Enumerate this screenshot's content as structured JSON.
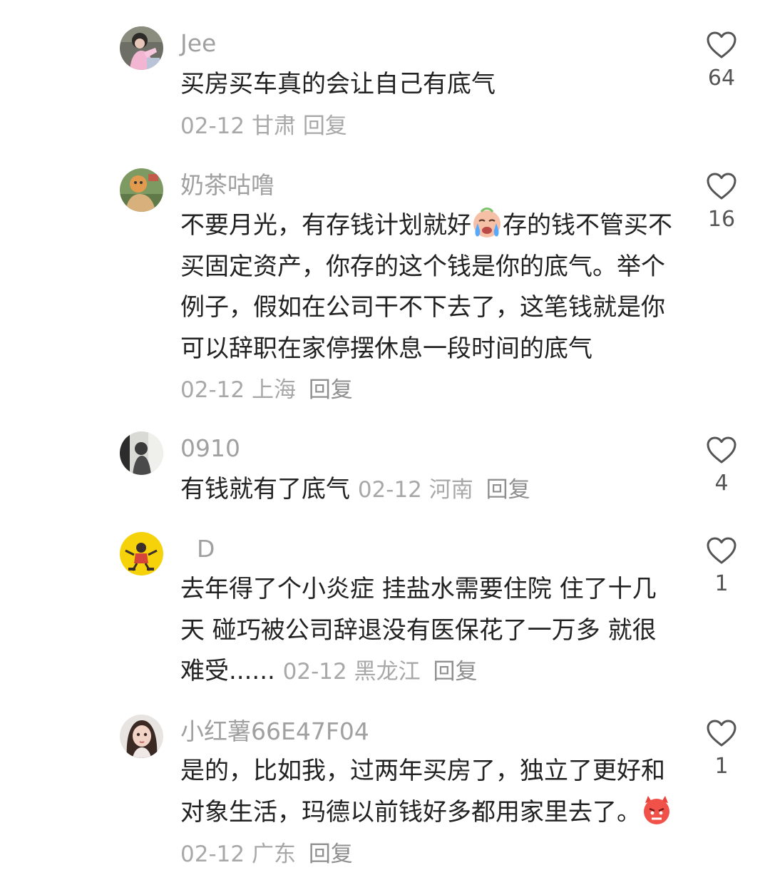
{
  "comments": [
    {
      "username": "Jee",
      "text": "买房买车真的会让自己有底气",
      "date": "02-12",
      "location": "甘肃",
      "reply_label": "回复",
      "likes": "64",
      "avatar_icon": "avatar-girl-pink-icon"
    },
    {
      "username": "奶茶咕噜",
      "text_before_emoji": "不要月光，有存钱计划就好",
      "emoji": "crying-face-emoji",
      "text_after_emoji": "存的钱不管买不买固定资产，你存的这个钱是你的底气。举个例子，假如在公司干不下去了，这笔钱就是你可以辞职在家停摆休息一段时间的底气",
      "date": "02-12",
      "location": "上海",
      "reply_label": "回复",
      "likes": "16",
      "avatar_icon": "avatar-cartoon-icon"
    },
    {
      "username": "0910",
      "text": "有钱就有了底气",
      "date": "02-12",
      "location": "河南",
      "reply_label": "回复",
      "likes": "4",
      "avatar_icon": "avatar-person-icon"
    },
    {
      "username": "D",
      "text": "去年得了个小炎症 挂盐水需要住院 住了十几天 碰巧被公司辞退没有医保花了一万多 就很难受......",
      "date": "02-12",
      "location": "黑龙江",
      "reply_label": "回复",
      "likes": "1",
      "avatar_icon": "avatar-yellow-cartoon-icon"
    },
    {
      "username": "小红薯66E47F04",
      "text": "是的，比如我，过两年买房了，独立了更好和对象生活，玛德以前钱好多都用家里去了。",
      "emoji": "angry-devil-emoji",
      "date": "02-12",
      "location": "广东",
      "reply_label": "回复",
      "likes": "1",
      "avatar_icon": "avatar-girl-icon"
    }
  ],
  "colors": {
    "text": "#222222",
    "meta": "#a8a8a8",
    "username": "#a0a0a0",
    "like_count": "#555555"
  }
}
